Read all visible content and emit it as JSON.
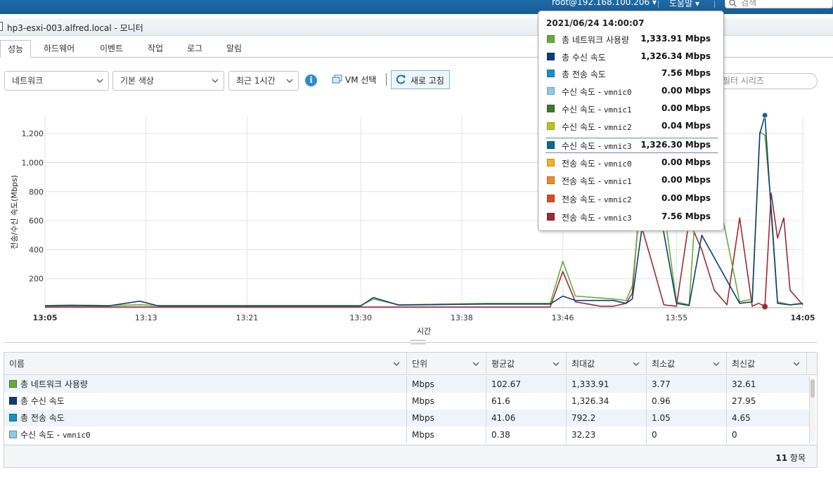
{
  "topbar": {
    "user": "root@192.168.100.206",
    "help": "도움말",
    "search_placeholder": "검색"
  },
  "window_title": "hp3-esxi-003.alfred.local - 모니터",
  "tabs": [
    "성능",
    "하드웨어",
    "이벤트",
    "작업",
    "로그",
    "알림"
  ],
  "active_tab": "성능",
  "toolbar": {
    "metric_select": "네트워크",
    "color_select": "기본 색상",
    "range_select": "최근 1시간",
    "vm_select_label": "VM 선택",
    "refresh_label": "새로 고침",
    "filter_placeholder": "필터 시리즈"
  },
  "tooltip": {
    "timestamp": "2021/06/24 14:00:07",
    "rows": [
      {
        "name": "총 네트워크 사용량",
        "nic": "",
        "value": "1,333.91 Mbps",
        "color": "#6aaa3a"
      },
      {
        "name": "총 수신 속도",
        "nic": "",
        "value": "1,326.34 Mbps",
        "color": "#0f3f73"
      },
      {
        "name": "총 전송 속도",
        "nic": "",
        "value": "7.56 Mbps",
        "color": "#1a8ed0"
      },
      {
        "name": "수신 속도 - ",
        "nic": "vmnic0",
        "value": "0.00 Mbps",
        "color": "#8ccbe3"
      },
      {
        "name": "수신 속도 - ",
        "nic": "vmnic1",
        "value": "0.00 Mbps",
        "color": "#3f7a2a"
      },
      {
        "name": "수신 속도 - ",
        "nic": "vmnic2",
        "value": "0.04 Mbps",
        "color": "#b5c424"
      },
      {
        "name": "수신 속도 - ",
        "nic": "vmnic3",
        "value": "1,326.30 Mbps",
        "color": "#0f6a8c"
      },
      {
        "name": "전송 속도 - ",
        "nic": "vmnic0",
        "value": "0.00 Mbps",
        "color": "#f1b323"
      },
      {
        "name": "전송 속도 - ",
        "nic": "vmnic1",
        "value": "0.00 Mbps",
        "color": "#f08a1e"
      },
      {
        "name": "전송 속도 - ",
        "nic": "vmnic2",
        "value": "0.00 Mbps",
        "color": "#d94f20"
      },
      {
        "name": "전송 속도 - ",
        "nic": "vmnic3",
        "value": "7.56 Mbps",
        "color": "#9b2b34"
      }
    ],
    "highlighted_index": 6
  },
  "chart_data": {
    "type": "line",
    "ylabel": "전송/수신 속도(Mbps)",
    "xlabel": "시간",
    "yticks": [
      200,
      400,
      600,
      800,
      "1,000",
      "1,200"
    ],
    "ylim": [
      0,
      1320
    ],
    "xticks": [
      "13:05",
      "13:13",
      "13:21",
      "13:30",
      "13:38",
      "13:46",
      "13:55",
      "14:05"
    ],
    "xticks_bold": [
      "13:05",
      "14:05"
    ],
    "xlim": [
      "13:05",
      "14:05"
    ],
    "grid": true,
    "series": [
      {
        "name": "총 네트워크 사용량",
        "color": "#6aaa3a",
        "x": [
          0,
          2,
          5,
          7.5,
          9,
          10,
          15,
          20,
          25,
          26,
          28,
          35,
          40,
          41,
          42,
          45,
          46,
          46.5,
          47,
          48,
          50,
          51,
          52,
          55,
          56,
          56.6,
          57,
          57.5,
          58,
          59,
          60
        ],
        "y": [
          15,
          18,
          15,
          20,
          15,
          15,
          15,
          15,
          15,
          60,
          20,
          30,
          30,
          320,
          80,
          60,
          50,
          150,
          600,
          1333,
          40,
          20,
          1333,
          40,
          60,
          1210,
          1190,
          700,
          40,
          20,
          32
        ]
      },
      {
        "name": "총 수신 속도",
        "color": "#0f3f73",
        "x": [
          0,
          2,
          5,
          7.5,
          9,
          10,
          15,
          20,
          25,
          26,
          28,
          35,
          40,
          41,
          42,
          45,
          46,
          46.5,
          47,
          48,
          50,
          51,
          52,
          55,
          56,
          56.6,
          57,
          57.5,
          58,
          59,
          60
        ],
        "y": [
          12,
          15,
          12,
          45,
          12,
          12,
          12,
          12,
          12,
          70,
          18,
          25,
          25,
          80,
          50,
          50,
          30,
          60,
          380,
          1000,
          30,
          15,
          500,
          30,
          40,
          1200,
          1326,
          660,
          30,
          20,
          28
        ]
      },
      {
        "name": "전송 속도 - vmnic3",
        "color": "#9b2b34",
        "x": [
          0,
          10,
          20,
          30,
          38,
          40,
          41,
          42,
          44,
          45,
          46,
          46.5,
          47,
          48,
          49,
          50,
          51,
          52,
          53,
          54,
          55,
          56,
          56.5,
          57,
          57.5,
          58,
          58.5,
          59,
          60
        ],
        "y": [
          5,
          5,
          5,
          5,
          5,
          5,
          250,
          40,
          10,
          10,
          30,
          100,
          630,
          330,
          20,
          10,
          600,
          400,
          120,
          20,
          620,
          10,
          30,
          10,
          790,
          480,
          620,
          120,
          20
        ]
      }
    ]
  },
  "table": {
    "columns": [
      "이름",
      "단위",
      "평균값",
      "최대값",
      "최소값",
      "최신값"
    ],
    "rows": [
      {
        "name": "총 네트워크 사용량",
        "nic": "",
        "color": "#6aaa3a",
        "unit": "Mbps",
        "avg": "102.67",
        "max": "1,333.91",
        "min": "3.77",
        "latest": "32.61"
      },
      {
        "name": "총 수신 속도",
        "nic": "",
        "color": "#0f3f73",
        "unit": "Mbps",
        "avg": "61.6",
        "max": "1,326.34",
        "min": "0.96",
        "latest": "27.95"
      },
      {
        "name": "총 전송 속도",
        "nic": "",
        "color": "#1a8ed0",
        "unit": "Mbps",
        "avg": "41.06",
        "max": "792.2",
        "min": "1.05",
        "latest": "4.65"
      },
      {
        "name": "수신 속도 - ",
        "nic": "vmnic0",
        "color": "#8ccbe3",
        "unit": "Mbps",
        "avg": "0.38",
        "max": "32.23",
        "min": "0",
        "latest": "0"
      }
    ],
    "count_number": "11",
    "count_label": "항목"
  }
}
